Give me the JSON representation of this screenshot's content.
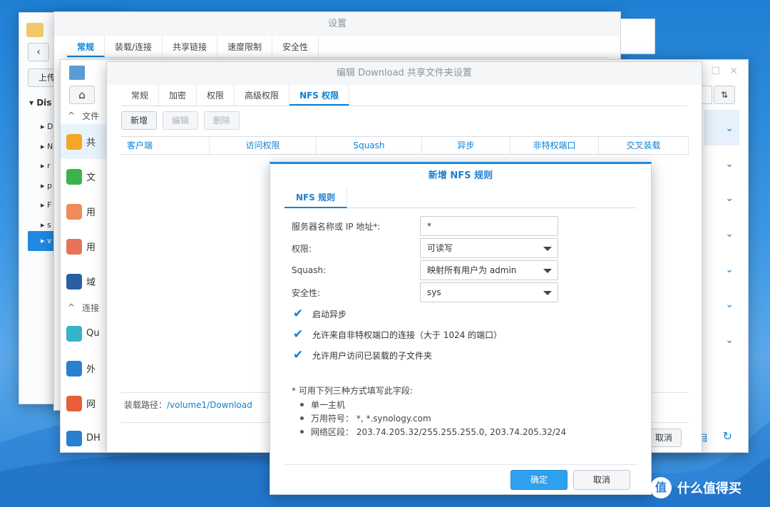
{
  "settings_window": {
    "title": "设置",
    "tabs": [
      "常规",
      "装载/连接",
      "共享链接",
      "速度限制",
      "安全性"
    ]
  },
  "file_station": {
    "back_icon": "chevron-left-icon",
    "upload_label": "上传",
    "tree_root": "Dis",
    "tree_items": [
      "D",
      "N",
      "r",
      "p",
      "F",
      "s",
      "v"
    ]
  },
  "share_window": {
    "title": "编辑 Download 共享文件夹设置",
    "tabs": [
      "常规",
      "加密",
      "权限",
      "高级权限",
      "NFS 权限"
    ],
    "toolbar": {
      "create": "新增",
      "edit": "编辑",
      "delete": "删除"
    },
    "columns": [
      "客户端",
      "访问权限",
      "Squash",
      "异步",
      "非特权端口",
      "交叉装载"
    ],
    "mount_path_label": "装载路径：",
    "mount_path_value": "/volume1/Download",
    "cancel_partial": "取消"
  },
  "control_panel": {
    "section_file": "文件",
    "section_conn": "连接",
    "items": [
      {
        "label": "共",
        "icon": "shared-folder-icon",
        "color": "#f5a623"
      },
      {
        "label": "文",
        "icon": "file-services-icon",
        "color": "#3bb34a"
      },
      {
        "label": "用",
        "icon": "user-icon",
        "color": "#f08a5d"
      },
      {
        "label": "用",
        "icon": "group-icon",
        "color": "#e8735a"
      },
      {
        "label": "域",
        "icon": "domain-icon",
        "color": "#2a5fa8"
      }
    ],
    "conn_items": [
      {
        "label": "Qu",
        "icon": "quickconnect-icon",
        "color": "#35b3c9"
      },
      {
        "label": "外",
        "icon": "external-access-icon",
        "color": "#2b7fd0"
      },
      {
        "label": "网",
        "icon": "network-icon",
        "color": "#e85d3a"
      },
      {
        "label": "DH",
        "icon": "dhcp-icon",
        "color": "#2b7fd0"
      }
    ],
    "sort_icon": "sort-icon",
    "refresh_icon": "refresh-icon",
    "partial_label": "目"
  },
  "dialog": {
    "title": "新增 NFS 规则",
    "tab": "NFS 规则",
    "fields": {
      "host_label": "服务器名称或 IP 地址*:",
      "host_value": "*",
      "privilege_label": "权限:",
      "privilege_value": "可读写",
      "squash_label": "Squash:",
      "squash_value": "映射所有用户为 admin",
      "security_label": "安全性:",
      "security_value": "sys"
    },
    "checkboxes": [
      {
        "label": "启动异步",
        "checked": true
      },
      {
        "label": "允许来自非特权端口的连接（大于 1024 的端口）",
        "checked": true
      },
      {
        "label": "允许用户访问已装载的子文件夹",
        "checked": true
      }
    ],
    "note_title": "* 可用下列三种方式填写此字段:",
    "note_items": [
      "单一主机",
      "万用符号：  *, *.synology.com",
      "网络区段：  203.74.205.32/255.255.255.0, 203.74.205.32/24"
    ],
    "ok": "确定",
    "cancel": "取消"
  },
  "watermark": "什么值得买"
}
